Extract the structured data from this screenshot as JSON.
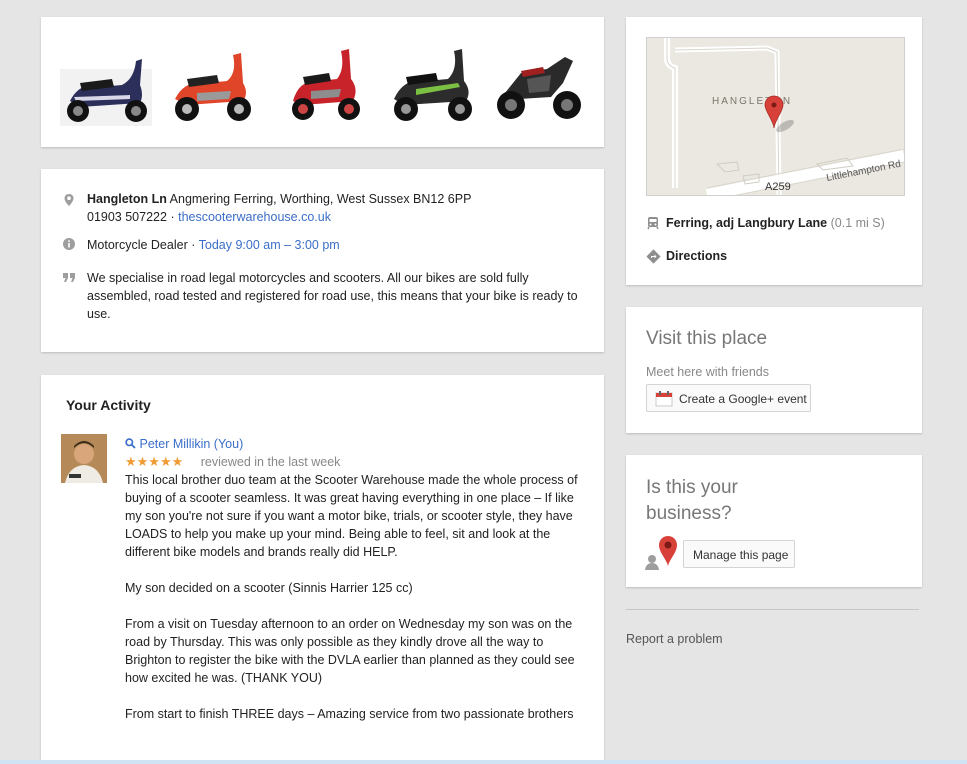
{
  "info": {
    "street": "Hangleton Ln",
    "address_rest": "Angmering Ferring, Worthing, West Sussex BN12 6PP",
    "phone": "01903 507222",
    "separator": "·",
    "website": "thescooterwarehouse.co.uk",
    "category": "Motorcycle Dealer",
    "hours": "Today 9:00 am – 3:00 pm",
    "description": "We specialise in road legal motorcycles and scooters. All our bikes are sold fully assembled, road tested and registered for road use, this means that your bike is ready to use."
  },
  "activity": {
    "title": "Your Activity",
    "reviewer": "Peter Millikin (You)",
    "stars": "★★★★★",
    "reviewed_when": "reviewed in the last week",
    "paragraphs": [
      "This local brother duo team at the Scooter Warehouse made the whole process of buying of a scooter seamless. It was great having everything in one place – If like my son you're not sure if you want a motor bike, trials, or scooter style, they have LOADS to help you make up your mind. Being able to feel, sit and look at the different bike models and brands really did HELP.",
      "My son decided on a scooter (Sinnis Harrier 125 cc)",
      "From a visit on Tuesday afternoon to an order on Wednesday my son was on the road by Thursday. This was only possible as they kindly drove all the way to Brighton to register the bike with the DVLA earlier than planned as they could see how excited he was. (THANK YOU)",
      "From start to finish THREE days – Amazing service from two passionate brothers"
    ]
  },
  "map": {
    "area_label": "HANGLETON",
    "road_label": "A259",
    "street_label": "Littlehampton Rd",
    "transit_stop": "Ferring, adj Langbury Lane",
    "transit_distance": "(0.1 mi S)",
    "directions": "Directions"
  },
  "visit": {
    "title": "Visit this place",
    "subtitle": "Meet here with friends",
    "button": "Create a Google+ event"
  },
  "business": {
    "title_line1": "Is this your",
    "title_line2": "business?",
    "button": "Manage this page"
  },
  "footer": {
    "report": "Report a problem"
  },
  "colors": {
    "link": "#3b6ec8",
    "stars": "#f09a33",
    "pin": "#d8413a"
  }
}
